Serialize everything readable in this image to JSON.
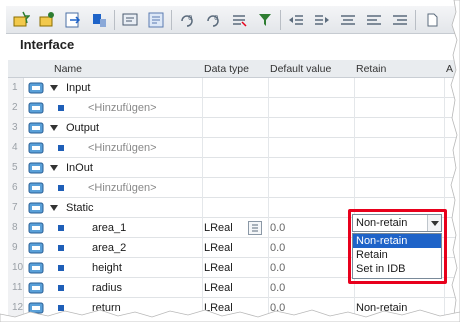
{
  "toolbar": {
    "icons": [
      "insert-row-icon",
      "add-row-icon",
      "export-icon",
      "import-icon",
      "monitor-icon",
      "compare-icon",
      "initialize-icon",
      "go-online-icon",
      "snapshot-icon",
      "filter-icon",
      "indent-icon",
      "outdent-icon",
      "align-icon",
      "align-left-icon",
      "align-right-icon",
      "help-icon"
    ]
  },
  "interface": {
    "title": "Interface",
    "columns": {
      "name": "Name",
      "data_type": "Data type",
      "default_value": "Default value",
      "retain": "Retain",
      "extra": "A"
    },
    "rows": [
      {
        "num": "1",
        "name": "Input",
        "type": "",
        "default": "",
        "retain": "",
        "section": true
      },
      {
        "num": "2",
        "name": "<Hinzufügen>",
        "type": "",
        "default": "",
        "retain": "",
        "placeholder": true
      },
      {
        "num": "3",
        "name": "Output",
        "type": "",
        "default": "",
        "retain": "",
        "section": true
      },
      {
        "num": "4",
        "name": "<Hinzufügen>",
        "type": "",
        "default": "",
        "retain": "",
        "placeholder": true
      },
      {
        "num": "5",
        "name": "InOut",
        "type": "",
        "default": "",
        "retain": "",
        "section": true
      },
      {
        "num": "6",
        "name": "<Hinzufügen>",
        "type": "",
        "default": "",
        "retain": "",
        "placeholder": true
      },
      {
        "num": "7",
        "name": "Static",
        "type": "",
        "default": "",
        "retain": "",
        "section": true
      },
      {
        "num": "8",
        "name": "area_1",
        "type": "LReal",
        "default": "0.0",
        "retain": ""
      },
      {
        "num": "9",
        "name": "area_2",
        "type": "LReal",
        "default": "0.0",
        "retain": ""
      },
      {
        "num": "10",
        "name": "height",
        "type": "LReal",
        "default": "0.0",
        "retain": ""
      },
      {
        "num": "11",
        "name": "radius",
        "type": "LReal",
        "default": "0.0",
        "retain": ""
      },
      {
        "num": "12",
        "name": "return",
        "type": "LReal",
        "default": "0.0",
        "retain": "Non-retain"
      }
    ]
  },
  "retain_dropdown": {
    "value": "Non-retain",
    "options": [
      "Non-retain",
      "Retain",
      "Set in IDB"
    ],
    "selected_option": "Non-retain"
  },
  "colors": {
    "accent": "#1e63c8",
    "highlight_box": "#e8001c"
  }
}
